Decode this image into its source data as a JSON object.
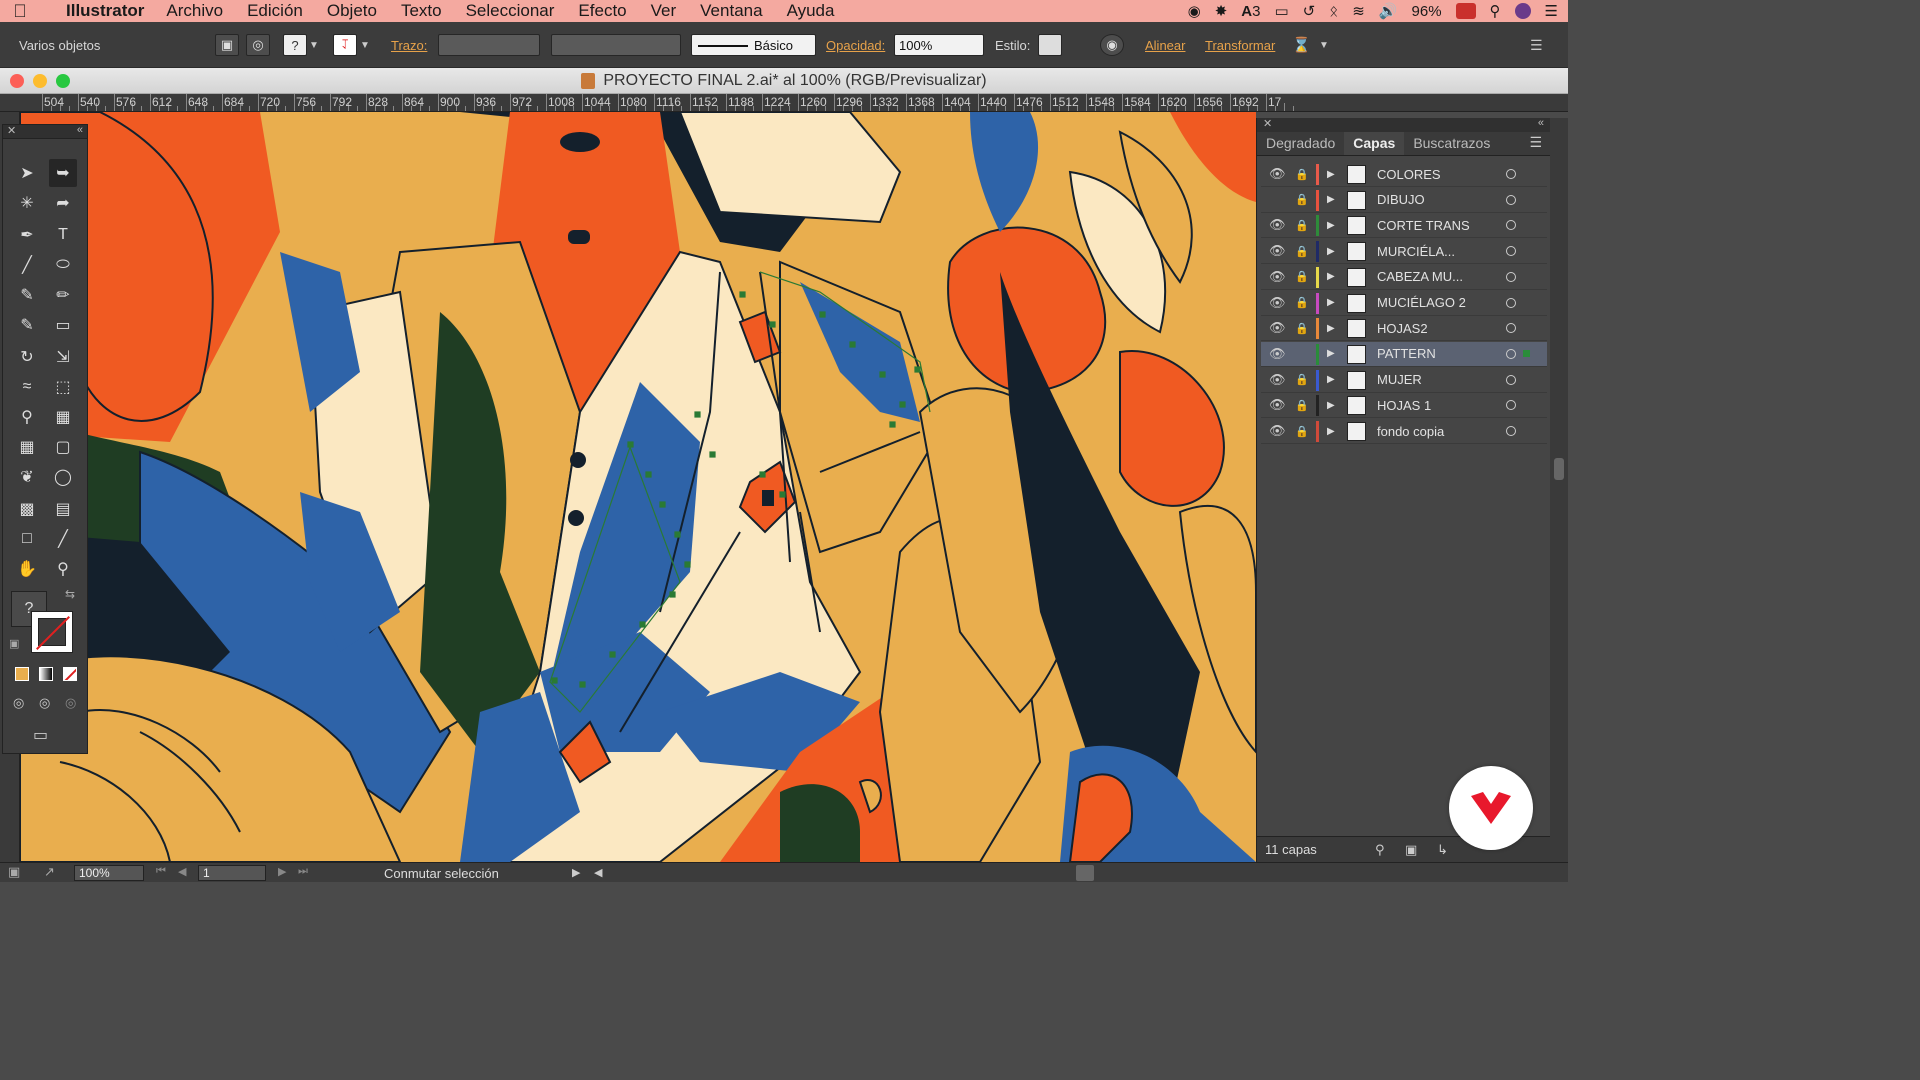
{
  "menubar": {
    "app_name": "Illustrator",
    "items": [
      "Archivo",
      "Edición",
      "Objeto",
      "Texto",
      "Seleccionar",
      "Efecto",
      "Ver",
      "Ventana",
      "Ayuda"
    ],
    "status": {
      "adobe_count": "3",
      "battery": "96%"
    }
  },
  "controlbar": {
    "selection_label": "Varios objetos",
    "stroke_label": "Trazo:",
    "stroke_profile": "Básico",
    "opacity_label": "Opacidad:",
    "opacity_value": "100%",
    "style_label": "Estilo:",
    "align_link": "Alinear",
    "transform_link": "Transformar"
  },
  "document": {
    "title": "PROYECTO FINAL 2.ai* al 100% (RGB/Previsualizar)"
  },
  "ruler": {
    "labels": [
      "504",
      "540",
      "576",
      "612",
      "648",
      "684",
      "720",
      "756",
      "792",
      "828",
      "864",
      "900",
      "936",
      "972",
      "1008",
      "1044",
      "1080",
      "1116",
      "1152",
      "1188",
      "1224",
      "1260",
      "1296",
      "1332",
      "1368",
      "1404",
      "1440",
      "1476",
      "1512",
      "1548",
      "1584",
      "1620",
      "1656",
      "1692",
      "17"
    ]
  },
  "layers_panel": {
    "tabs": [
      "Degradado",
      "Capas",
      "Buscatrazos"
    ],
    "active_tab": "Capas",
    "layers": [
      {
        "name": "COLORES",
        "color": "#e85a4a",
        "visible": true,
        "locked": true
      },
      {
        "name": "DIBUJO",
        "color": "#e8523e",
        "visible": false,
        "locked": true
      },
      {
        "name": "CORTE TRANS",
        "color": "#2e8b3a",
        "visible": true,
        "locked": true
      },
      {
        "name": "MURCIÉLA...",
        "color": "#1f2a66",
        "visible": true,
        "locked": true
      },
      {
        "name": "CABEZA MU...",
        "color": "#e6d84a",
        "visible": true,
        "locked": true
      },
      {
        "name": "MUCIÉLAGO 2",
        "color": "#c84ac0",
        "visible": true,
        "locked": true
      },
      {
        "name": "HOJAS2",
        "color": "#e8883a",
        "visible": true,
        "locked": true
      },
      {
        "name": "PATTERN",
        "color": "#2a8c3a",
        "visible": true,
        "locked": false,
        "selected": true
      },
      {
        "name": "MUJER",
        "color": "#3a5ad0",
        "visible": true,
        "locked": true
      },
      {
        "name": "HOJAS 1",
        "color": "#222222",
        "visible": true,
        "locked": true
      },
      {
        "name": "fondo copia",
        "color": "#d04a3a",
        "visible": true,
        "locked": true
      }
    ],
    "footer_count": "11 capas"
  },
  "statusbar": {
    "zoom": "100%",
    "artboard": "1",
    "tool_status": "Conmutar selección"
  },
  "colors": {
    "menubar_bg": "#f4a9a0",
    "ui_dark": "#3c3c3c",
    "accent_link": "#e7a24a",
    "art_orange": "#f05a22",
    "art_mustard": "#e9ae4e",
    "art_cream": "#fbe8c2",
    "art_blue": "#2e63a8",
    "art_green": "#1f3d23",
    "art_navy": "#14202c"
  }
}
